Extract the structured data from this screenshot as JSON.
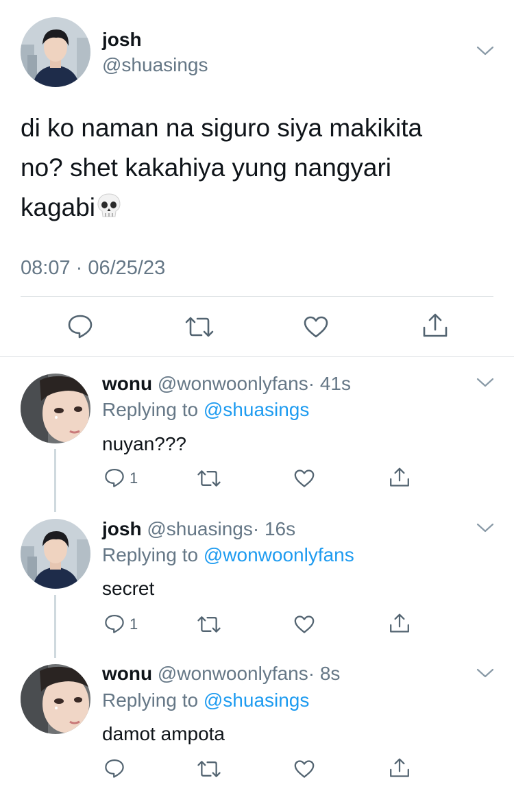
{
  "main_tweet": {
    "display_name": "josh",
    "handle": "@shuasings",
    "text_line1": "di ko naman na siguro siya makikita",
    "text_line2": "no? shet kakahiya yung nangyari",
    "text_line3": "kagabi",
    "emoji": "💀",
    "timestamp": "08:07 · 06/25/23",
    "actions": [
      "reply-icon",
      "retweet-icon",
      "like-icon",
      "share-icon"
    ]
  },
  "replies": [
    {
      "display_name": "wonu",
      "handle": "@wonwoonlyfans",
      "time": "· 41s",
      "replying_prefix": "Replying to",
      "replying_to": "@shuasings",
      "text": "nuyan???",
      "reply_count": "1"
    },
    {
      "display_name": "josh",
      "handle": "@shuasings",
      "time": "· 16s",
      "replying_prefix": "Replying to",
      "replying_to": "@wonwoonlyfans",
      "text": "secret",
      "reply_count": "1"
    },
    {
      "display_name": "wonu",
      "handle": "@wonwoonlyfans",
      "time": "· 8s",
      "replying_prefix": "Replying to",
      "replying_to": "@shuasings",
      "text": "damot ampota",
      "reply_count": ""
    }
  ],
  "colors": {
    "link": "#1d9bf0",
    "secondary": "#657786",
    "icon": "#536471",
    "thread_line": "#cfd9de"
  }
}
